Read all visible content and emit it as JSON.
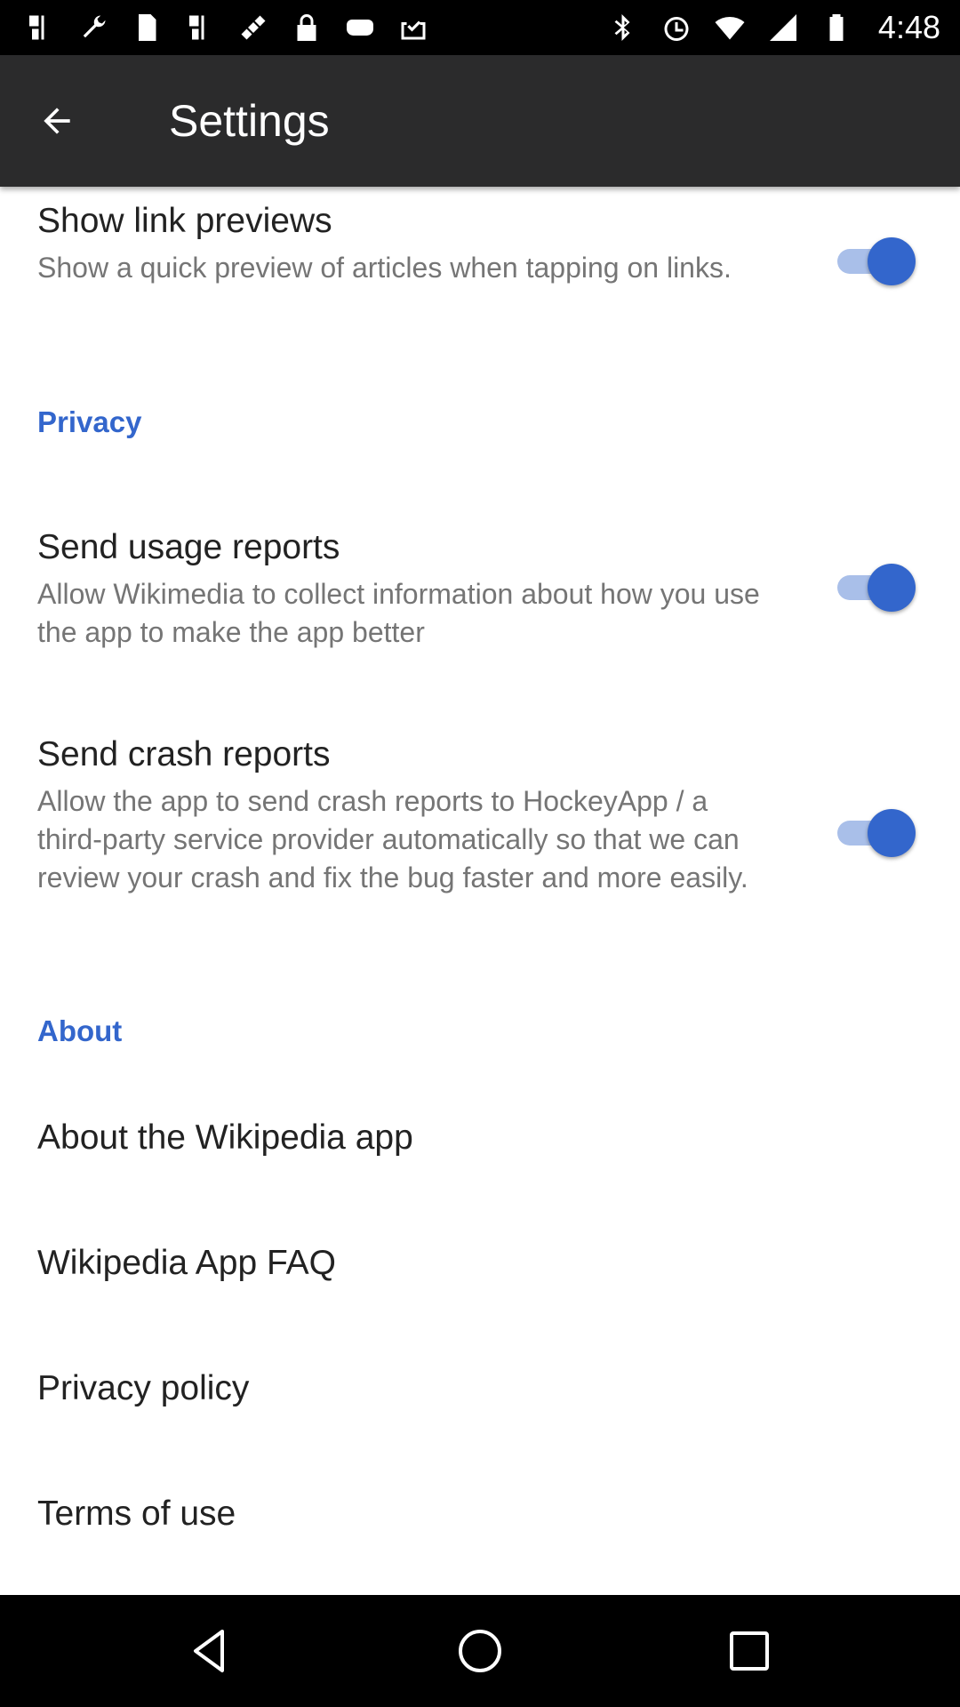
{
  "status_bar": {
    "time": "4:48",
    "left_icons": [
      "pinwheel-icon",
      "wrench-icon",
      "sim-icon",
      "pinwheel-icon",
      "satellite-fake-gps-icon",
      "lock-icon",
      "game-controller-icon",
      "inbox-check-icon"
    ],
    "right_icons": [
      "bluetooth-icon",
      "alarm-icon",
      "wifi-icon",
      "signal-icon",
      "battery-icon"
    ]
  },
  "app_bar": {
    "title": "Settings"
  },
  "prefs": {
    "link_previews": {
      "title": "Show link previews",
      "summary": "Show a quick preview of articles when tapping on links.",
      "enabled": true
    },
    "privacy_header": "Privacy",
    "usage_reports": {
      "title": "Send usage reports",
      "summary": "Allow Wikimedia to collect information about how you use the app to make the app better",
      "enabled": true
    },
    "crash_reports": {
      "title": "Send crash reports",
      "summary": "Allow the app to send crash reports to HockeyApp / a third-party service provider automatically so that we can review your crash and fix the bug faster and more easily.",
      "enabled": true
    },
    "about_header": "About",
    "about_items": [
      "About the Wikipedia app",
      "Wikipedia App FAQ",
      "Privacy policy",
      "Terms of use"
    ]
  },
  "colors": {
    "accent": "#3366cc",
    "app_bar": "#2b2b2c"
  }
}
